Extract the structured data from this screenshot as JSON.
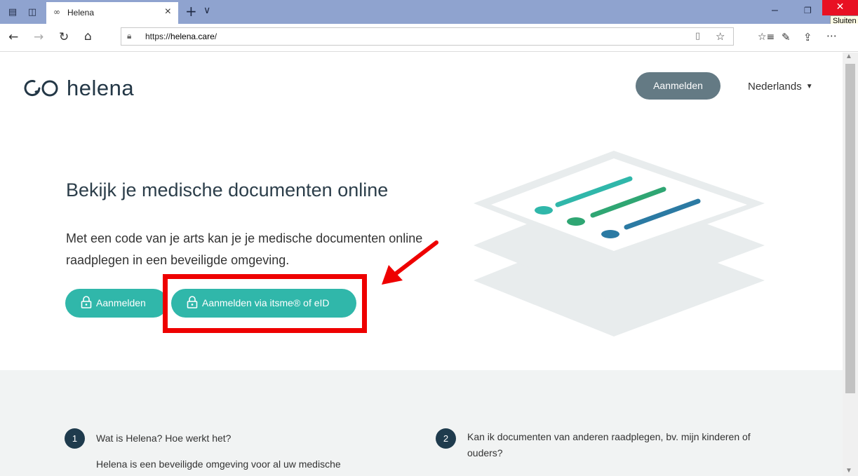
{
  "browser": {
    "tab_title": "Helena",
    "tab_close": "×",
    "new_tab": "+",
    "tab_list": "∨",
    "url_prefix": "https://",
    "url_host": "helena.care",
    "url_suffix": "/",
    "window_close_tooltip": "Sluiten",
    "minimize": "–",
    "maximize": "❐",
    "close": "✕"
  },
  "header": {
    "logo_text": "helena",
    "login_label": "Aanmelden",
    "language": "Nederlands"
  },
  "hero": {
    "title": "Bekijk je medische documenten online",
    "text": "Met een code van je arts kan je je medische documenten online raadplegen in een beveiligde omgeving.",
    "login_button": "Aanmelden",
    "itsme_button": "Aanmelden via itsme® of eID"
  },
  "info": {
    "items": [
      {
        "number": "1",
        "question": "Wat is Helena? Hoe werkt het?",
        "answer": "Helena is een beveiligde omgeving voor al uw medische"
      },
      {
        "number": "2",
        "question": "Kan ik documenten van anderen raadplegen, bv. mijn kinderen of ouders?",
        "answer": ""
      }
    ]
  },
  "colors": {
    "teal": "#30b7aa",
    "annotation_red": "#ee0000",
    "dark_navy": "#1f3b4d",
    "header_button": "#647a84"
  }
}
